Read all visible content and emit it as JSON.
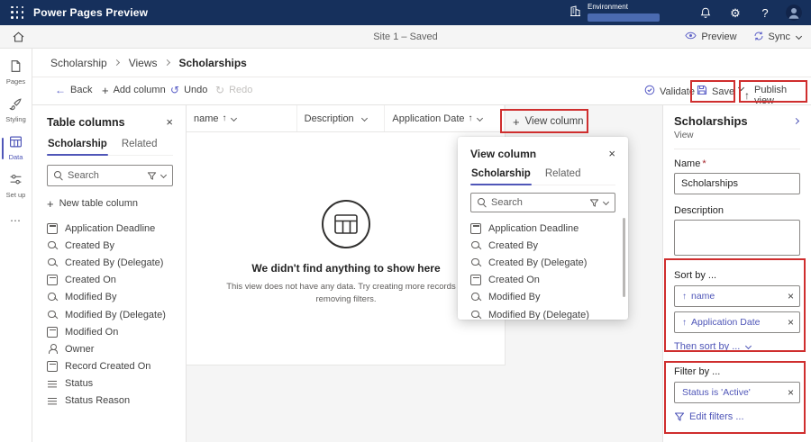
{
  "icons": {
    "plus": "+",
    "back_arrow": "←",
    "undo": "↺",
    "redo": "↻",
    "publish_arrow": "↑",
    "sort_ascending": "↑",
    "dismiss": "×",
    "close": "×",
    "more": "⋯",
    "gear": "⚙",
    "help": "?"
  },
  "colors": {
    "top_bar": "#16305c",
    "accent": "#4f56b8",
    "annotation": "#cf2e2e"
  },
  "top_bar": {
    "app_title": "Power Pages Preview",
    "environment_label": "Environment"
  },
  "site_bar": {
    "site_status": "Site 1 – Saved",
    "preview_label": "Preview",
    "sync_label": "Sync"
  },
  "nav_rail": {
    "items": [
      {
        "label": "Pages"
      },
      {
        "label": "Styling"
      },
      {
        "label": "Data",
        "selected": true
      },
      {
        "label": "Set up"
      }
    ]
  },
  "breadcrumb": {
    "items": [
      "Scholarship",
      "Views",
      "Scholarships"
    ]
  },
  "toolbar": {
    "back_label": "Back",
    "add_column_label": "Add column",
    "undo_label": "Undo",
    "redo_label": "Redo",
    "validate_label": "Validate",
    "save_label": "Save",
    "publish_label": "Publish view"
  },
  "table_columns_panel": {
    "title": "Table columns",
    "tabs": [
      {
        "label": "Scholarship",
        "selected": true
      },
      {
        "label": "Related",
        "selected": false
      }
    ],
    "search_placeholder": "Search",
    "new_column_label": "New table column",
    "items": [
      {
        "label": "Application Deadline",
        "icon": "calendar"
      },
      {
        "label": "Created By",
        "icon": "lookup"
      },
      {
        "label": "Created By (Delegate)",
        "icon": "lookup"
      },
      {
        "label": "Created On",
        "icon": "calendar"
      },
      {
        "label": "Modified By",
        "icon": "lookup"
      },
      {
        "label": "Modified By (Delegate)",
        "icon": "lookup"
      },
      {
        "label": "Modified On",
        "icon": "calendar"
      },
      {
        "label": "Owner",
        "icon": "person"
      },
      {
        "label": "Record Created On",
        "icon": "calendar"
      },
      {
        "label": "Status",
        "icon": "status"
      },
      {
        "label": "Status Reason",
        "icon": "status"
      }
    ]
  },
  "grid": {
    "columns": [
      {
        "label": "name",
        "arrow": "↑"
      },
      {
        "label": "Description",
        "arrow": ""
      },
      {
        "label": "Application Date",
        "arrow": "↑"
      }
    ],
    "view_column_label": "View column",
    "empty_title": "We didn't find anything to show here",
    "empty_subtext": "This view does not have any data. Try creating more records or removing filters."
  },
  "view_column_popup": {
    "title": "View column",
    "tabs": [
      {
        "label": "Scholarship",
        "selected": true
      },
      {
        "label": "Related",
        "selected": false
      }
    ],
    "search_placeholder": "Search",
    "items": [
      {
        "label": "Application Deadline",
        "icon": "calendar"
      },
      {
        "label": "Created By",
        "icon": "lookup"
      },
      {
        "label": "Created By (Delegate)",
        "icon": "lookup"
      },
      {
        "label": "Created On",
        "icon": "calendar"
      },
      {
        "label": "Modified By",
        "icon": "lookup"
      },
      {
        "label": "Modified By (Delegate)",
        "icon": "lookup"
      }
    ]
  },
  "properties_panel": {
    "title": "Scholarships",
    "subtitle": "View",
    "name_label": "Name",
    "required_marker": "*",
    "name_value": "Scholarships",
    "description_label": "Description",
    "sort_section_label": "Sort by ...",
    "sort_items": [
      {
        "label": "name"
      },
      {
        "label": "Application Date"
      }
    ],
    "then_sort_label": "Then sort by ...",
    "filter_section_label": "Filter by ...",
    "filter_items": [
      {
        "label": "Status is 'Active'"
      }
    ],
    "edit_filters_label": "Edit filters ..."
  }
}
